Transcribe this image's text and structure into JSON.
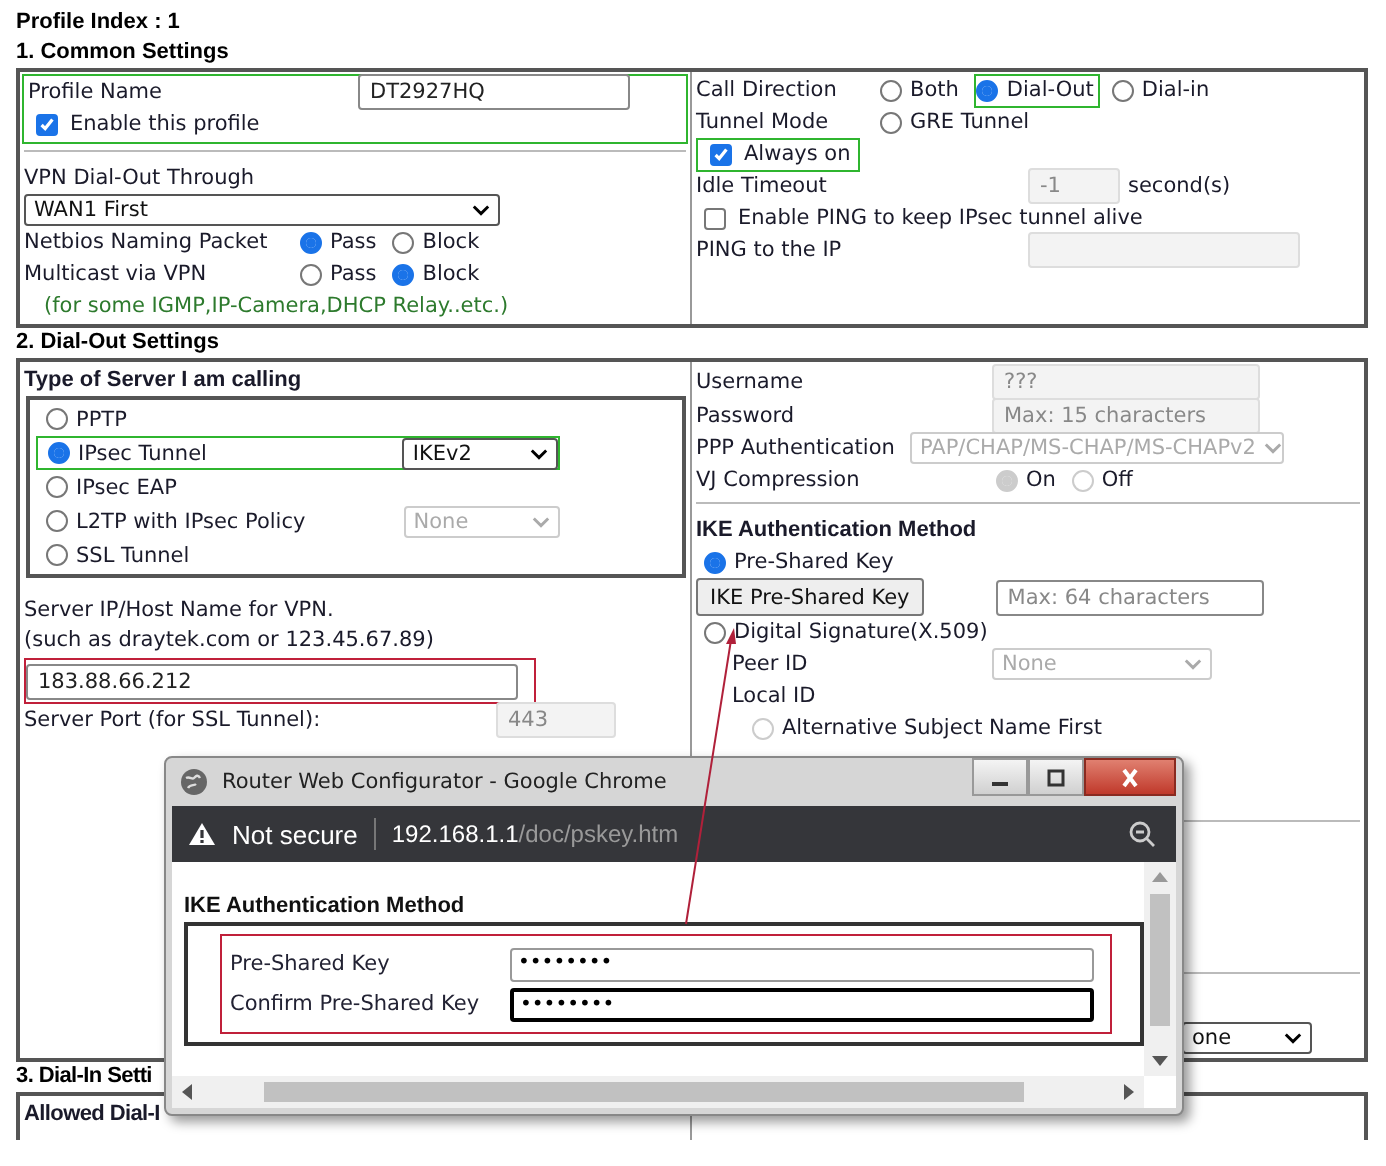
{
  "profile_index": "Profile Index : 1",
  "common": {
    "title": "1. Common Settings",
    "profile_name": {
      "label": "Profile Name",
      "value": "DT2927HQ"
    },
    "enable_profile": {
      "label": "Enable this profile",
      "checked": true
    },
    "dial_out_through": {
      "label": "VPN Dial-Out Through",
      "value": "WAN1 First"
    },
    "netbios": {
      "label": "Netbios Naming Packet",
      "options": [
        {
          "label": "Pass",
          "selected": true
        },
        {
          "label": "Block",
          "selected": false
        }
      ]
    },
    "multicast": {
      "label": "Multicast via VPN",
      "options": [
        {
          "label": "Pass",
          "selected": false
        },
        {
          "label": "Block",
          "selected": true
        }
      ]
    },
    "multicast_note": "(for some IGMP,IP-Camera,DHCP Relay..etc.)",
    "call_direction": {
      "label": "Call Direction",
      "options": [
        {
          "label": "Both",
          "selected": false
        },
        {
          "label": "Dial-Out",
          "selected": true
        },
        {
          "label": "Dial-in",
          "selected": false
        }
      ]
    },
    "tunnel_mode": {
      "label": "Tunnel Mode",
      "options": [
        {
          "label": "GRE Tunnel",
          "selected": false
        }
      ]
    },
    "always_on": {
      "label": "Always on",
      "checked": true
    },
    "idle_timeout": {
      "label": "Idle Timeout",
      "value": "-1",
      "unit": "second(s)"
    },
    "enable_ping": {
      "label": "Enable PING to keep IPsec tunnel alive",
      "checked": false
    },
    "ping_ip": {
      "label": "PING to the IP"
    }
  },
  "dial_out": {
    "title": "2. Dial-Out Settings",
    "server_type_heading": "Type of Server I am calling",
    "server_types": [
      {
        "label": "PPTP",
        "selected": false
      },
      {
        "label": "IPsec Tunnel",
        "selected": true,
        "select": {
          "value": "IKEv2",
          "disabled": false
        }
      },
      {
        "label": "IPsec EAP",
        "selected": false
      },
      {
        "label": "L2TP with IPsec Policy",
        "selected": false,
        "select": {
          "value": "None",
          "disabled": true
        }
      },
      {
        "label": "SSL Tunnel",
        "selected": false
      }
    ],
    "server_host_label": "Server IP/Host Name for VPN.",
    "server_host_hint": "(such as draytek.com or 123.45.67.89)",
    "server_host_value": "183.88.66.212",
    "server_port": {
      "label": "Server Port (for SSL Tunnel):",
      "value": "443"
    },
    "username": {
      "label": "Username",
      "value": "???"
    },
    "password": {
      "label": "Password",
      "placeholder": "Max: 15 characters"
    },
    "ppp_auth": {
      "label": "PPP Authentication",
      "value": "PAP/CHAP/MS-CHAP/MS-CHAPv2"
    },
    "vj_compression": {
      "label": "VJ Compression",
      "disabled": true,
      "options": [
        {
          "label": "On",
          "selected": true
        },
        {
          "label": "Off",
          "selected": false
        }
      ]
    },
    "ike_heading": "IKE Authentication Method",
    "pre_shared": {
      "label": "Pre-Shared Key",
      "selected": true,
      "button": "IKE Pre-Shared Key",
      "placeholder": "Max: 64 characters"
    },
    "digital_signature": {
      "label": "Digital Signature(X.509)",
      "selected": false
    },
    "peer_id": {
      "label": "Peer ID",
      "value": "None"
    },
    "local_id": {
      "label": "Local ID"
    },
    "alt_subject": {
      "label": "Alternative Subject Name First",
      "selected": false,
      "disabled": true
    },
    "lower_select": {
      "value": "one"
    }
  },
  "dial_in": {
    "title": "3. Dial-In Setti",
    "allowed": "Allowed Dial-I"
  },
  "popup": {
    "title": "Router Web Configurator - Google Chrome",
    "security": "Not secure",
    "url_host": "192.168.1.1",
    "url_path": "/doc/pskey.htm",
    "heading": "IKE Authentication Method",
    "fields": [
      {
        "label": "Pre-Shared Key",
        "value": "••••••••",
        "focused": false
      },
      {
        "label": "Confirm Pre-Shared Key",
        "value": "••••••••",
        "focused": true
      }
    ]
  }
}
